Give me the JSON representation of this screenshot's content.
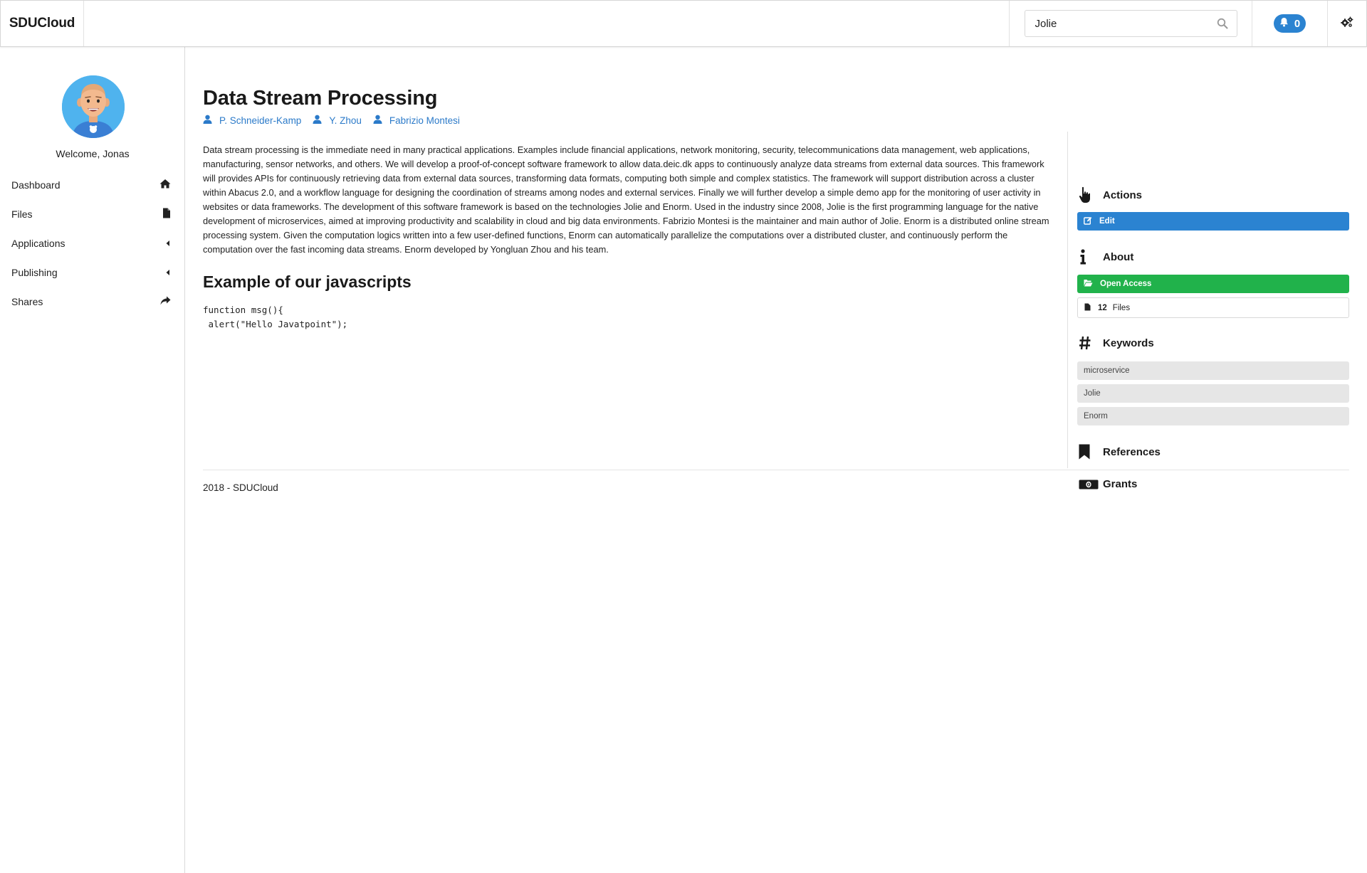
{
  "app": {
    "brand": "SDUCloud"
  },
  "search": {
    "value": "Jolie",
    "placeholder": ""
  },
  "notifications": {
    "count": "0"
  },
  "sidebar": {
    "welcome": "Welcome, Jonas",
    "items": [
      {
        "label": "Dashboard",
        "icon": "home-icon"
      },
      {
        "label": "Files",
        "icon": "file-icon"
      },
      {
        "label": "Applications",
        "icon": "caret-left-icon"
      },
      {
        "label": "Publishing",
        "icon": "caret-left-icon"
      },
      {
        "label": "Shares",
        "icon": "share-icon"
      }
    ]
  },
  "main": {
    "title": "Data Stream Processing",
    "authors": [
      "P. Schneider-Kamp",
      "Y. Zhou",
      "Fabrizio Montesi"
    ],
    "description": "Data stream processing is the immediate need in many practical applications. Examples include financial applications, network monitoring, security, telecommunications data management, web applications, manufacturing, sensor networks, and others. We will develop a proof-of-concept software framework to allow data.deic.dk apps to continuously analyze data streams from external data sources. This framework will provides APIs for continuously retrieving data from external data sources, transforming data formats, computing both simple and complex statistics. The framework will support distribution across a cluster within Abacus 2.0, and a workflow language for designing the coordination of streams among nodes and external services. Finally we will further develop a simple demo app for the monitoring of user activity in websites or data frameworks. The development of this software framework is based on the technologies Jolie and Enorm. Used in the industry since 2008, Jolie is the first programming language for the native development of microservices, aimed at improving productivity and scalability in cloud and big data environments. Fabrizio Montesi is the maintainer and main author of Jolie. Enorm is a distributed online stream processing system. Given the computation logics written into a few user-defined functions, Enorm can automatically parallelize the computations over a distributed cluster, and continuously perform the computation over the fast incoming data streams. Enorm developed by Yongluan Zhou and his team.",
    "subheading": "Example of our javascripts",
    "code": "function msg(){\n alert(\"Hello Javatpoint\");",
    "footer": "2018 - SDUCloud"
  },
  "panel": {
    "actions": {
      "heading": "Actions",
      "edit_label": "Edit"
    },
    "about": {
      "heading": "About",
      "access_label": "Open Access",
      "files_count": "12",
      "files_label": "Files"
    },
    "keywords": {
      "heading": "Keywords",
      "items": [
        "microservice",
        "Jolie",
        "Enorm"
      ]
    },
    "references": {
      "heading": "References"
    },
    "grants": {
      "heading": "Grants"
    }
  },
  "colors": {
    "primary": "#2b83d1",
    "success": "#21b24b",
    "link": "#2b7ac9",
    "keyword_bg": "#e6e6e6"
  }
}
